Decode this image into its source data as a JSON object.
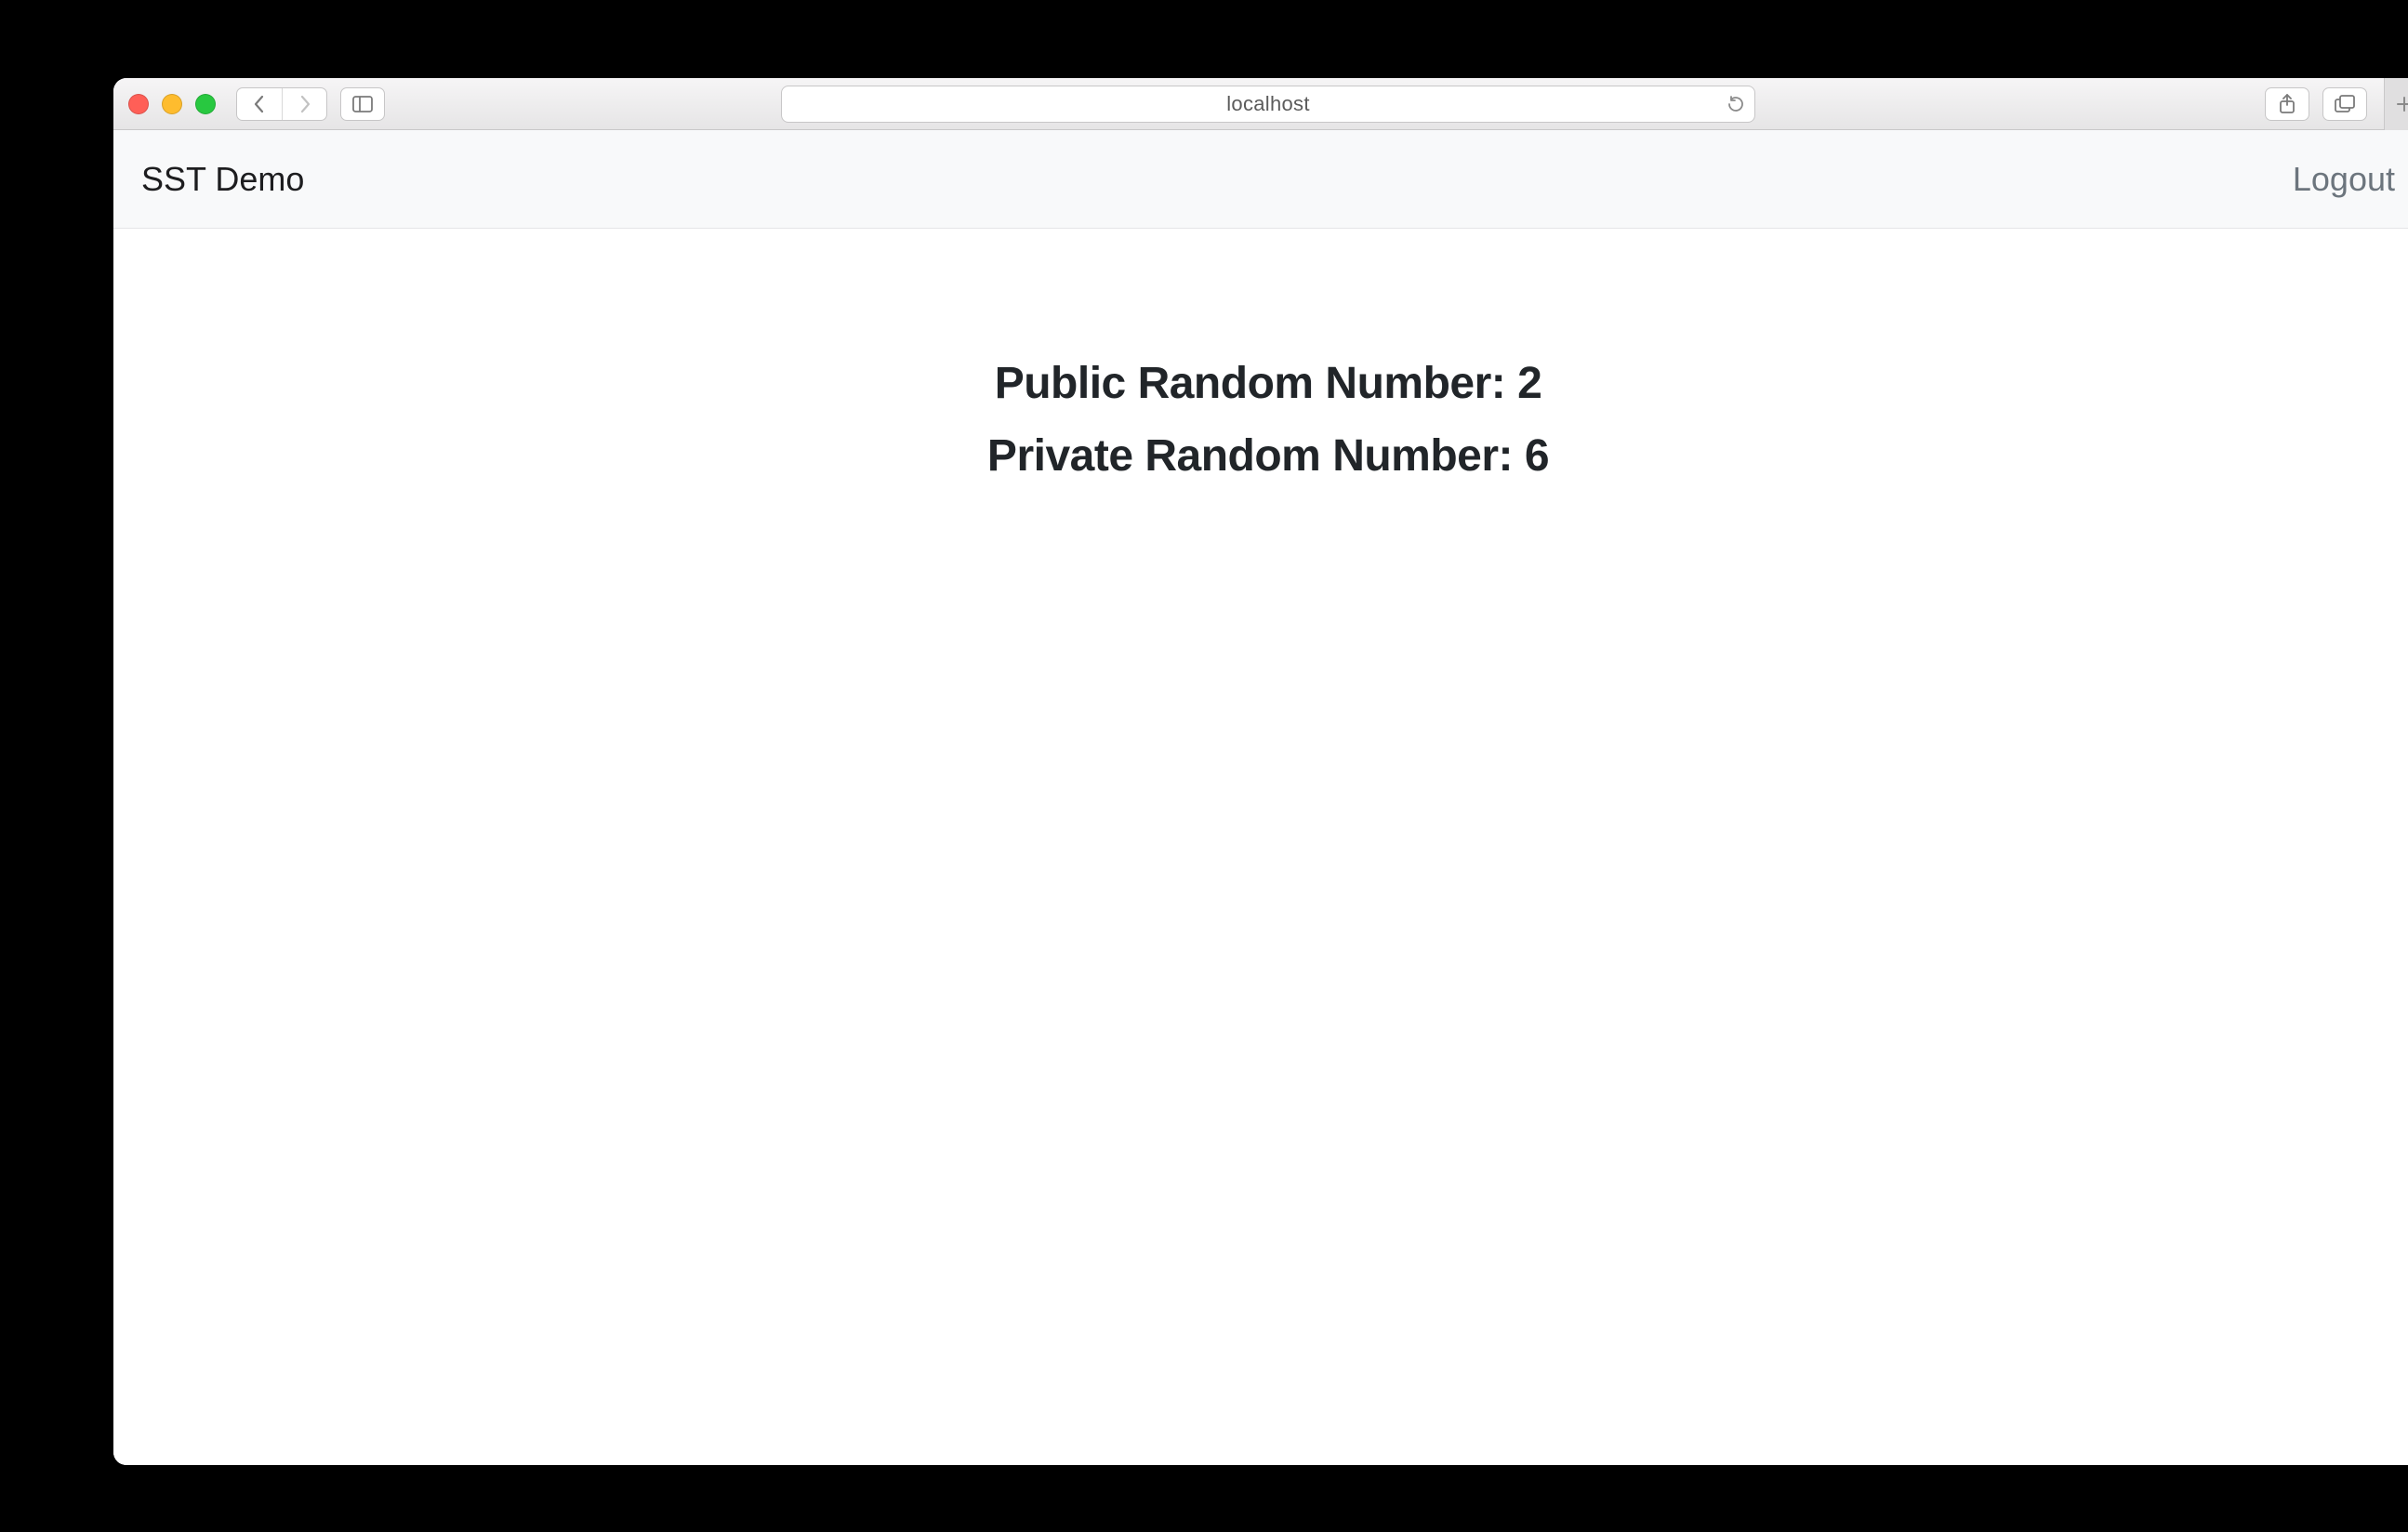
{
  "browser": {
    "address_text": "localhost"
  },
  "navbar": {
    "brand": "SST Demo",
    "logout_label": "Logout"
  },
  "content": {
    "public_label": "Public Random Number: ",
    "public_value": "2",
    "private_label": "Private Random Number: ",
    "private_value": "6"
  }
}
